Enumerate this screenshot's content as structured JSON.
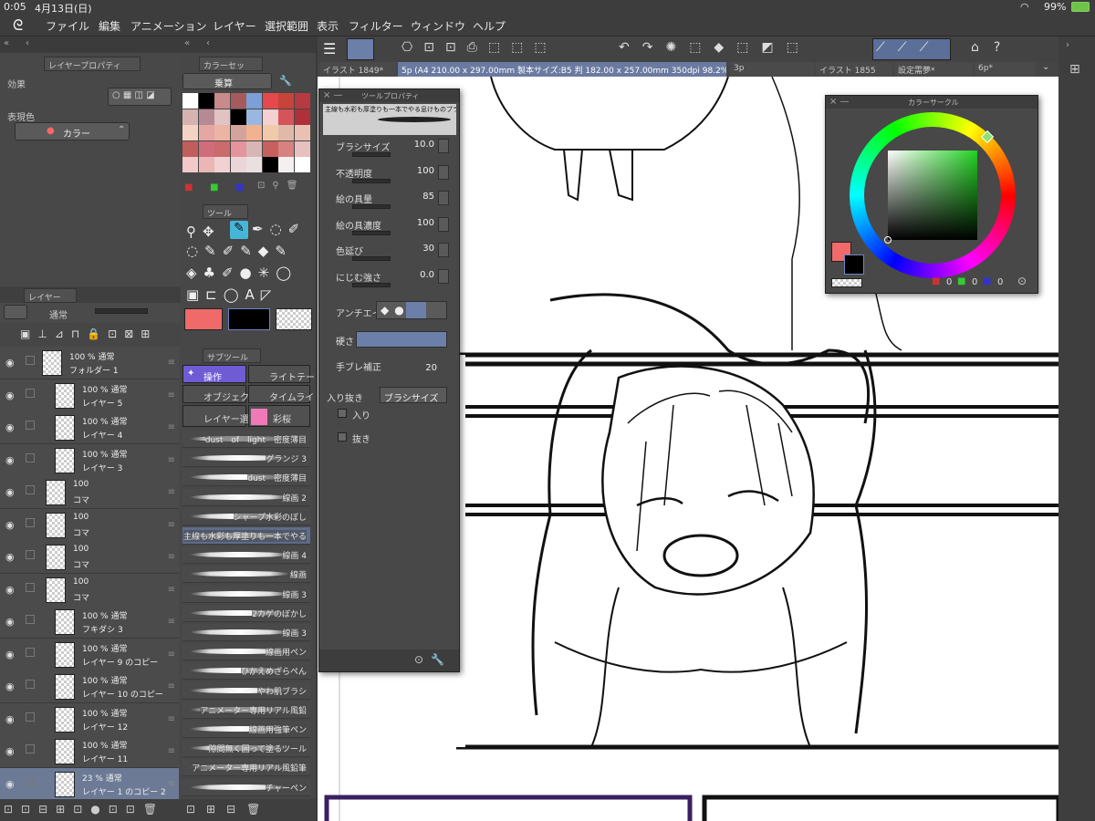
{
  "status": {
    "time": "0:05",
    "date": "4月13日(日)",
    "battery": "99%"
  },
  "menu": [
    "ファイル",
    "編集",
    "アニメーション",
    "レイヤー",
    "選択範囲",
    "表示",
    "フィルター",
    "ウィンドウ",
    "ヘルプ"
  ],
  "left_panel": {
    "layer_property_tab": "レイヤープロパティ",
    "effect_label": "効果",
    "expression_label": "表現色",
    "expression_value": "カラー"
  },
  "color_set": {
    "tab": "カラーセッ",
    "mode": "乗算"
  },
  "tools": {
    "tab": "ツール"
  },
  "layers": {
    "tab": "レイヤー",
    "blend": "通常",
    "rows": [
      {
        "pct": "100 % 通常",
        "name": "フォルダー 1"
      },
      {
        "pct": "100 % 通常",
        "name": "レイヤー 5"
      },
      {
        "pct": "100 % 通常",
        "name": "レイヤー 4"
      },
      {
        "pct": "100 % 通常",
        "name": "レイヤー 3"
      },
      {
        "pct": "100",
        "name": "コマ"
      },
      {
        "pct": "100",
        "name": "コマ"
      },
      {
        "pct": "100",
        "name": "コマ"
      },
      {
        "pct": "100",
        "name": "コマ"
      },
      {
        "pct": "100 % 通常",
        "name": "フキダシ 3"
      },
      {
        "pct": "100 % 通常",
        "name": "レイヤー 9 のコピー"
      },
      {
        "pct": "100 % 通常",
        "name": "レイヤー 10 のコピー"
      },
      {
        "pct": "100 % 通常",
        "name": "レイヤー 12"
      },
      {
        "pct": "100 % 通常",
        "name": "レイヤー 11"
      },
      {
        "pct": "23 % 通常",
        "name": "レイヤー 1 のコピー 2"
      }
    ]
  },
  "subtool": {
    "tab": "サブツール",
    "groups": [
      "操作",
      "ライトテー",
      "オブジェク",
      "タイムライ",
      "レイヤー選",
      "彩桜"
    ],
    "brushes": [
      "dust　of　light　密度薄目",
      "グランジ 3",
      "dust　密度薄目",
      "線画 2",
      "シャープ水彩のぼし",
      "主線も水彩も厚塗りも一本でやる",
      "線画 4",
      "線画",
      "線画 3",
      "2カゲのぼかし",
      "線画 3",
      "線画用ペン",
      "ひかえめざらぺん",
      "やわ肌ブラシ",
      "アニメーター専用リアル風鉛",
      "線画用強筆ペン",
      "隙間無く囲って塗るツール",
      "アニメーター専用リアル風鉛筆",
      "チャーペン"
    ]
  },
  "tool_property": {
    "title": "ツールプロパティ",
    "brush_name": "主線も水彩も厚塗りも一本でやる息けものブラ",
    "rows": [
      {
        "label": "ブラシサイズ",
        "value": "10.0"
      },
      {
        "label": "不透明度",
        "value": "100"
      },
      {
        "label": "絵の具量",
        "value": "85"
      },
      {
        "label": "絵の具濃度",
        "value": "100"
      },
      {
        "label": "色延び",
        "value": "30"
      },
      {
        "label": "にじむ強さ",
        "value": "0.0"
      }
    ],
    "antialias": "アンチエイリ",
    "hardness": "硬さ",
    "stabilization": "手ブレ補正",
    "stabilization_value": "20",
    "taper": "入り抜き",
    "taper_mode": "ブラシサイズ",
    "taper_in": "入り",
    "taper_out": "抜き"
  },
  "doc_tabs": [
    "イラスト 1849*",
    "5p (A4 210.00 x 297.00mm 製本サイズ:B5 判 182.00 x 257.00mm 350dpi 98.2%)",
    "3p",
    "イラスト 1855",
    "設定需夢*",
    "6p*"
  ],
  "color_circle": {
    "title": "カラーサークル",
    "main_color": "#f06a6a",
    "sub_color": "#000000",
    "rgb": [
      "0",
      "0",
      "0"
    ]
  }
}
